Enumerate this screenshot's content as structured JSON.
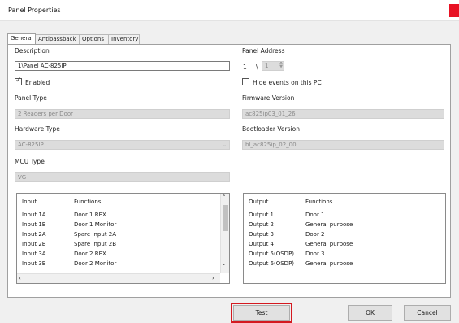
{
  "window": {
    "title": "Panel Properties"
  },
  "tabs": [
    {
      "label": "General"
    },
    {
      "label": "Antipassback"
    },
    {
      "label": "Options"
    },
    {
      "label": "Inventory"
    }
  ],
  "general": {
    "description_label": "Description",
    "description_value": "1\\Panel AC-825IP",
    "enabled_label": "Enabled",
    "panel_type_label": "Panel Type",
    "panel_type_value": "2 Readers per Door",
    "hardware_type_label": "Hardware Type",
    "hardware_type_value": "AC-825IP",
    "mcu_type_label": "MCU Type",
    "mcu_type_value": "VG",
    "panel_address_label": "Panel Address",
    "panel_address_a": "1",
    "panel_address_sep": "\\",
    "panel_address_b": "1",
    "hide_events_label": "Hide events on this PC",
    "firmware_label": "Firmware Version",
    "firmware_value": "ac825ip03_01_26",
    "bootloader_label": "Bootloader Version",
    "bootloader_value": "bl_ac825ip_02_00"
  },
  "inputs": {
    "headers": [
      "Input",
      "Functions"
    ],
    "rows": [
      [
        "Input 1A",
        "Door 1 REX"
      ],
      [
        "Input 1B",
        "Door 1 Monitor"
      ],
      [
        "Input 2A",
        "Spare Input 2A"
      ],
      [
        "Input 2B",
        "Spare Input 2B"
      ],
      [
        "Input 3A",
        "Door 2 REX"
      ],
      [
        "Input 3B",
        "Door 2 Monitor"
      ]
    ]
  },
  "outputs": {
    "headers": [
      "Output",
      "Functions"
    ],
    "rows": [
      [
        "Output 1",
        "Door 1"
      ],
      [
        "Output 2",
        "General purpose"
      ],
      [
        "Output 3",
        "Door 2"
      ],
      [
        "Output 4",
        "General purpose"
      ],
      [
        "Output 5(OSDP)",
        "Door 3"
      ],
      [
        "Output 6(OSDP)",
        "General purpose"
      ]
    ]
  },
  "buttons": {
    "test": "Test",
    "ok": "OK",
    "cancel": "Cancel"
  },
  "colors": {
    "highlight": "#d41920",
    "close": "#e81123"
  }
}
